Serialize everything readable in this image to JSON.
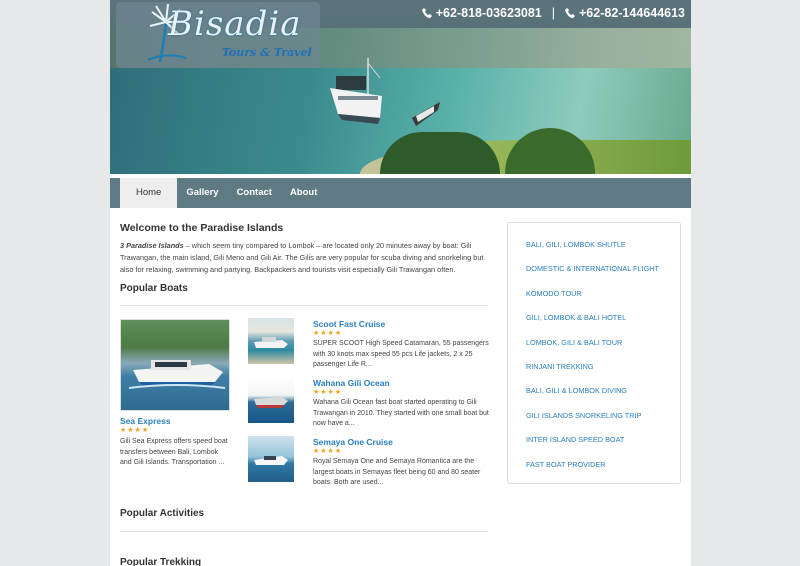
{
  "header": {
    "logo_text": "Bisadia",
    "logo_subtitle": "Tours & Travel",
    "phone1": "+62-818-03623081",
    "separator": "|",
    "phone2": "+62-82-144644613"
  },
  "nav": {
    "items": [
      {
        "label": "Home",
        "active": true
      },
      {
        "label": "Gallery",
        "active": false
      },
      {
        "label": "Contact",
        "active": false
      },
      {
        "label": "About",
        "active": false
      }
    ]
  },
  "welcome": {
    "title": "Welcome to the Paradise Islands",
    "lead": "3 Paradise Islands",
    "body": " – which seem tiny compared to Lombok – are located only 20 minutes away by boat: Gili Trawangan, the main island, Gili Meno and Gili Air. The Gilis are very popular for scuba diving and snorkeling but also for relaxing, swimming and partying. Backpackers and tourists visit especially Gili Trawangan often."
  },
  "popular_boats": {
    "title": "Popular Boats",
    "featured": {
      "title": "Sea Express",
      "stars": "★★★★",
      "description": "Gili Sea Express offers speed boat transfers between Bali, Lombok and Gili Islands. Transportation ..."
    },
    "items": [
      {
        "title": "Scoot Fast Cruise",
        "stars": "★★★★",
        "description": "SUPER SCOOT High Speed Catamaran, 55 passengers with 30 knots max speed 55 pcs Life jackets, 2 x 25 passenger Life R..."
      },
      {
        "title": "Wahana Gili Ocean",
        "stars": "★★★★",
        "description": "Wahana Gili Ocean fast boat started operating to Gili Trawangan in 2010. They started with one small boat but now have a..."
      },
      {
        "title": "Semaya One Cruise",
        "stars": "★★★★",
        "description": "Royal Semaya One and Semaya Romantica are the largest boats in Semayas fleet being 60 and 80 seater boats. Both are used..."
      }
    ]
  },
  "popular_activities": {
    "title": "Popular Activities"
  },
  "popular_trekking": {
    "title": "Popular Trekking"
  },
  "sidebar": {
    "links": [
      "BALI, GILI, LOMBOK SHUTLE",
      "DOMESTIC & INTERNATIONAL FLIGHT",
      "KOMODO TOUR",
      "GILI, LOMBOK & BALI HOTEL",
      "LOMBOK, GILI & BALI TOUR",
      "RINJANI TREKKING",
      "BALI, GILI & LOMBOK DIVING",
      "GILI ISLANDS SNORKELING TRIP",
      "INTER ISLAND SPEED BOAT",
      "FAST BOAT PROVIDER"
    ]
  },
  "colors": {
    "nav_bg": "#5f7a83",
    "link": "#2a7fbf",
    "stars": "#f0a020"
  }
}
